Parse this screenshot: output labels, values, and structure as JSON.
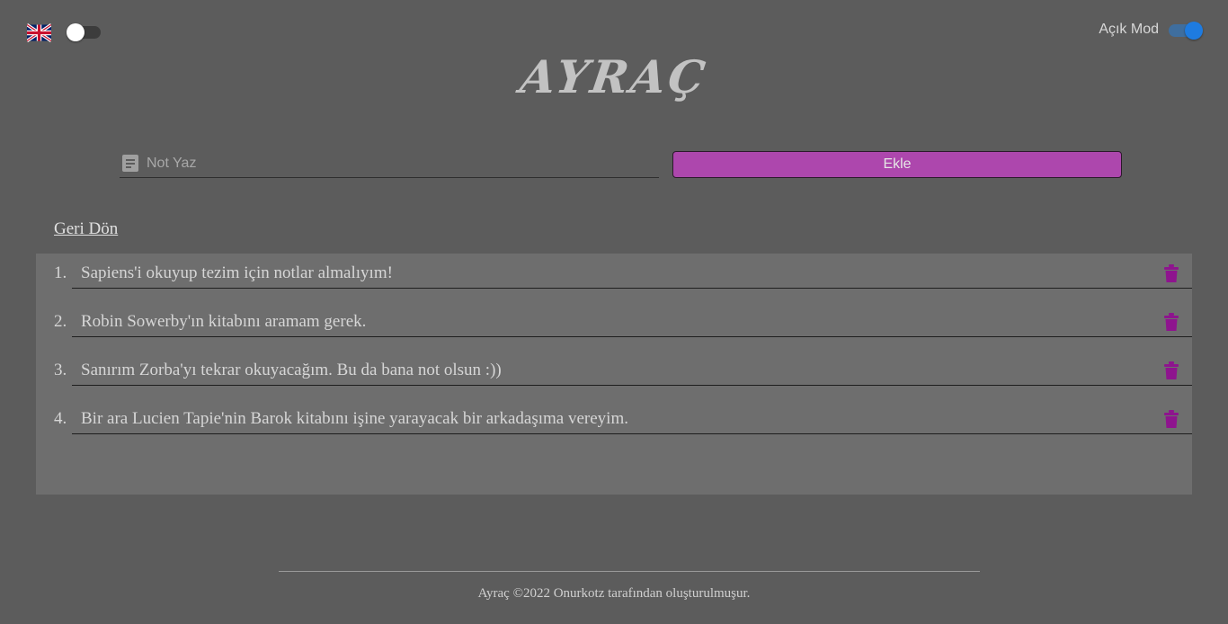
{
  "header": {
    "language_flag_icon": "uk-flag-icon",
    "mode_label": "Açık Mod",
    "logo": "AYRAÇ"
  },
  "form": {
    "note_placeholder": "Not Yaz",
    "note_value": "",
    "note_icon": "note-icon",
    "add_label": "Ekle"
  },
  "back_link": "Geri Dön",
  "notes": [
    {
      "num": "1.",
      "text": "Sapiens'i okuyup tezim için notlar almalıyım!"
    },
    {
      "num": "2.",
      "text": "Robin Sowerby'ın kitabını aramam gerek."
    },
    {
      "num": "3.",
      "text": "Sanırım Zorba'yı tekrar okuyacağım. Bu da bana not olsun :))"
    },
    {
      "num": "4.",
      "text": "Bir ara Lucien Tapie'nin Barok kitabını işine yarayacak bir arkadaşıma vereyim."
    }
  ],
  "footer": {
    "text": "Ayraç ©2022 Onurkotz tarafından oluşturulmuşur."
  },
  "colors": {
    "background": "#5c5c5c",
    "panel": "#6e6e6e",
    "accent": "#ad47ad",
    "trash": "#8e148e",
    "toggle_on": "#1e7be0"
  }
}
